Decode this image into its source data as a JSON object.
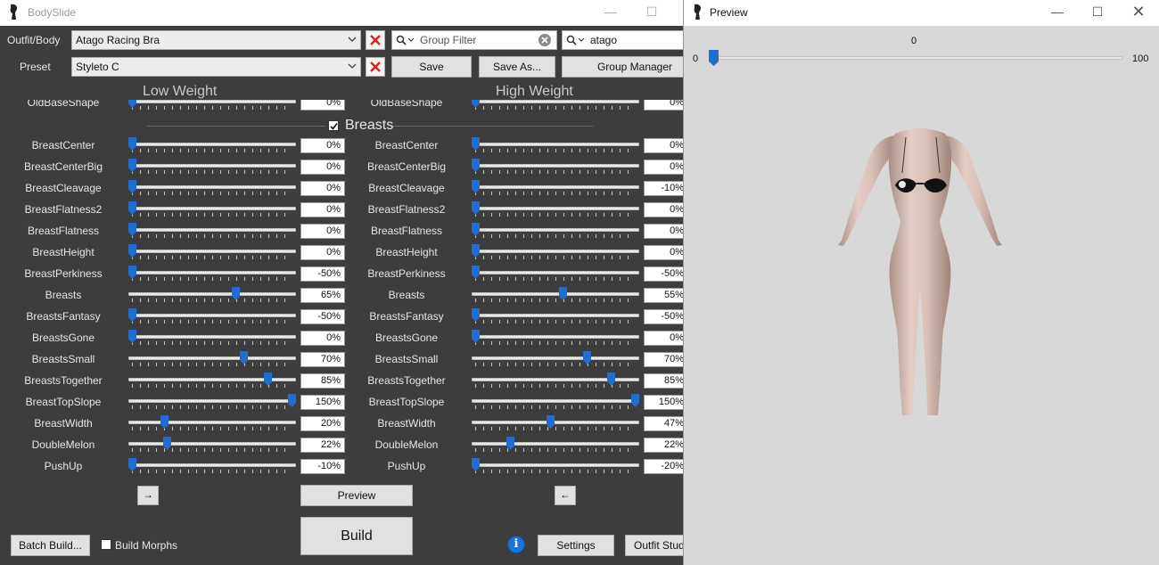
{
  "main_window": {
    "title": "BodySlide",
    "outfit_label": "Outfit/Body",
    "outfit_value": "Atago Racing Bra",
    "preset_label": "Preset",
    "preset_value": "Styleto C",
    "group_filter_placeholder": "Group Filter",
    "outfit_filter_value": "atago",
    "save_label": "Save",
    "save_as_label": "Save As...",
    "group_manager_label": "Group Manager",
    "low_weight_header": "Low Weight",
    "high_weight_header": "High Weight",
    "partial_row": {
      "name": "OldBaseShape",
      "low": "0%",
      "high": "0%"
    },
    "category": "Breasts",
    "sliders": [
      {
        "name": "BreastCenter",
        "low": "0%",
        "high": "0%",
        "low_pos": 0,
        "high_pos": 0
      },
      {
        "name": "BreastCenterBig",
        "low": "0%",
        "high": "0%",
        "low_pos": 0,
        "high_pos": 0
      },
      {
        "name": "BreastCleavage",
        "low": "0%",
        "high": "-10%",
        "low_pos": 0,
        "high_pos": 0
      },
      {
        "name": "BreastFlatness2",
        "low": "0%",
        "high": "0%",
        "low_pos": 0,
        "high_pos": 0
      },
      {
        "name": "BreastFlatness",
        "low": "0%",
        "high": "0%",
        "low_pos": 0,
        "high_pos": 0
      },
      {
        "name": "BreastHeight",
        "low": "0%",
        "high": "0%",
        "low_pos": 0,
        "high_pos": 0
      },
      {
        "name": "BreastPerkiness",
        "low": "-50%",
        "high": "-50%",
        "low_pos": 0,
        "high_pos": 0
      },
      {
        "name": "Breasts",
        "low": "65%",
        "high": "55%",
        "low_pos": 0.65,
        "high_pos": 0.55
      },
      {
        "name": "BreastsFantasy",
        "low": "-50%",
        "high": "-50%",
        "low_pos": 0,
        "high_pos": 0
      },
      {
        "name": "BreastsGone",
        "low": "0%",
        "high": "0%",
        "low_pos": 0,
        "high_pos": 0
      },
      {
        "name": "BreastsSmall",
        "low": "70%",
        "high": "70%",
        "low_pos": 0.7,
        "high_pos": 0.7
      },
      {
        "name": "BreastsTogether",
        "low": "85%",
        "high": "85%",
        "low_pos": 0.85,
        "high_pos": 0.85
      },
      {
        "name": "BreastTopSlope",
        "low": "150%",
        "high": "150%",
        "low_pos": 1,
        "high_pos": 1
      },
      {
        "name": "BreastWidth",
        "low": "20%",
        "high": "47%",
        "low_pos": 0.2,
        "high_pos": 0.47
      },
      {
        "name": "DoubleMelon",
        "low": "22%",
        "high": "22%",
        "low_pos": 0.22,
        "high_pos": 0.22
      },
      {
        "name": "PushUp",
        "low": "-10%",
        "high": "-20%",
        "low_pos": 0,
        "high_pos": 0
      }
    ],
    "copy_right_arrow": "→",
    "copy_left_arrow": "←",
    "preview_label": "Preview",
    "build_label": "Build",
    "batch_build_label": "Batch Build...",
    "build_morphs_label": "Build Morphs",
    "info_label": "i",
    "settings_label": "Settings",
    "outfit_studio_label": "Outfit Studi"
  },
  "preview_window": {
    "title": "Preview",
    "weight_value": "0",
    "weight_min": "0",
    "weight_max": "100",
    "weight_level": 0
  },
  "colors": {
    "panel_bg": "#3d3d3d",
    "accent_blue": "#1e6fcf",
    "delete_red": "#e02020",
    "preview_bg": "#d8d8d8"
  }
}
